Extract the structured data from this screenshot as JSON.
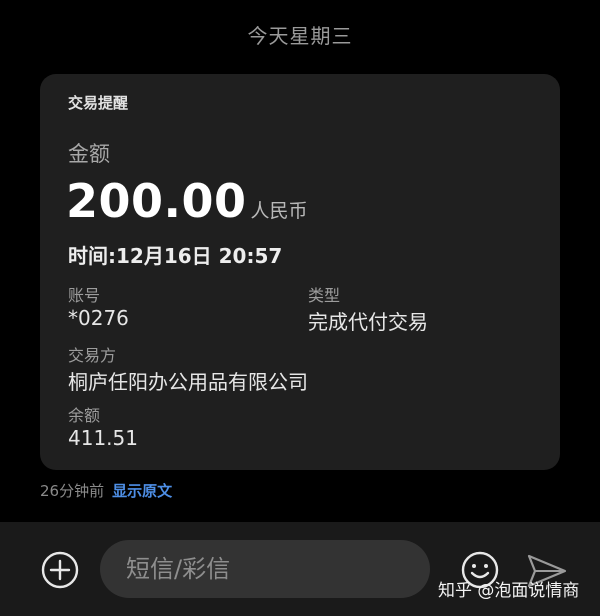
{
  "date_header": "今天星期三",
  "card": {
    "title": "交易提醒",
    "amount_label": "金额",
    "amount_value": "200.00",
    "amount_currency": "人民币",
    "time_text": "时间:12月16日 20:57",
    "account_label": "账号",
    "account_value": "*0276",
    "type_label": "类型",
    "type_value": "完成代付交易",
    "counterparty_label": "交易方",
    "counterparty_value": "桐庐任阳办公用品有限公司",
    "balance_label": "余额",
    "balance_value": "411.51"
  },
  "message_meta": {
    "time_ago": "26分钟前",
    "show_original": "显示原文"
  },
  "composer": {
    "input_placeholder": "短信/彩信",
    "add_icon": "plus-circle-icon",
    "emoji_icon": "smiley-icon",
    "send_icon": "send-icon"
  },
  "watermark": "知乎 @泡面说情商",
  "colors": {
    "background": "#000000",
    "card": "#1f1f1f",
    "link": "#4e8fe6",
    "input": "#333333"
  }
}
